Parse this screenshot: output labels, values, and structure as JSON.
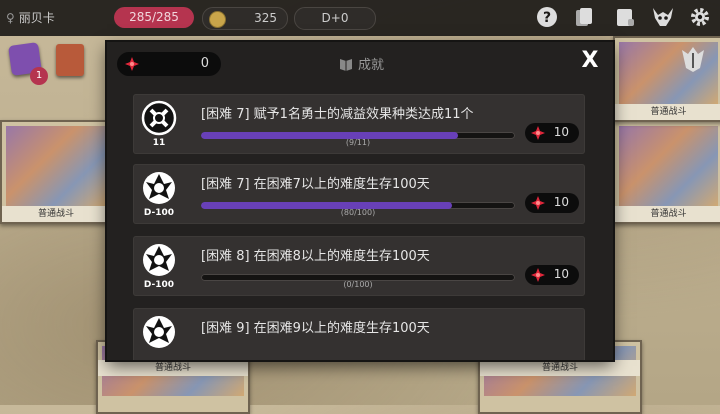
{
  "topbar": {
    "player_name": "丽贝卡",
    "hp": "285/285",
    "gold": "325",
    "day": "D+0"
  },
  "dice_badge": "1",
  "background_cards": [
    "普通战斗",
    "普通战斗",
    "普通战斗",
    "普通战斗",
    "普通战斗"
  ],
  "modal": {
    "points": "0",
    "title": "成就",
    "close_label": "X",
    "achievements": [
      {
        "title": "[困难 7] 赋予1名勇士的减益效果种类达成11个",
        "icon": "debuff-icon",
        "icon_label": "11",
        "progress_text": "(9/11)",
        "progress": 0.818,
        "reward": "10"
      },
      {
        "title": "[困难 7] 在困难7以上的难度生存100天",
        "icon": "survival-emblem-icon",
        "icon_label": "D-100",
        "progress_text": "(80/100)",
        "progress": 0.8,
        "reward": "10"
      },
      {
        "title": "[困难 8] 在困难8以上的难度生存100天",
        "icon": "survival-emblem-icon",
        "icon_label": "D-100",
        "progress_text": "(0/100)",
        "progress": 0.0,
        "reward": "10"
      },
      {
        "title": "[困难 9] 在困难9以上的难度生存100天",
        "icon": "survival-emblem-icon",
        "icon_label": "",
        "progress_text": "",
        "progress": 0.0,
        "reward": ""
      }
    ]
  },
  "colors": {
    "accent": "#6840b8",
    "hp": "#b5344f",
    "gem": "#e0263a"
  }
}
